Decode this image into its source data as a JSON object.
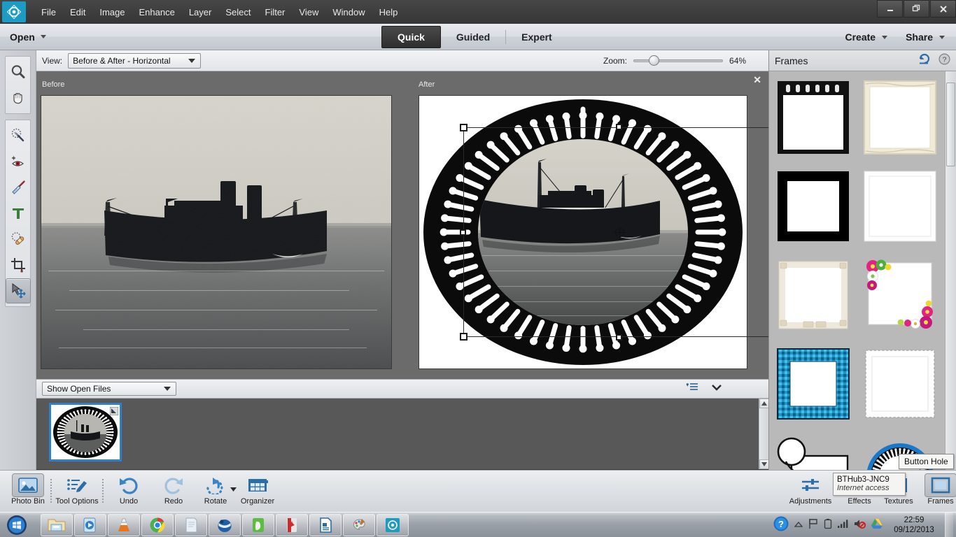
{
  "window": {
    "app_name": "Adobe Photoshop Elements",
    "minimize": "—",
    "restore": "❐",
    "close": "✕"
  },
  "menubar": {
    "items": [
      {
        "label": "File"
      },
      {
        "label": "Edit"
      },
      {
        "label": "Image"
      },
      {
        "label": "Enhance"
      },
      {
        "label": "Layer"
      },
      {
        "label": "Select"
      },
      {
        "label": "Filter"
      },
      {
        "label": "View"
      },
      {
        "label": "Window"
      },
      {
        "label": "Help"
      }
    ]
  },
  "modebar": {
    "open_label": "Open",
    "tabs": [
      {
        "label": "Quick",
        "active": true
      },
      {
        "label": "Guided",
        "active": false
      },
      {
        "label": "Expert",
        "active": false
      }
    ],
    "create_label": "Create",
    "share_label": "Share"
  },
  "optionbar": {
    "view_label": "View:",
    "view_value": "Before & After - Horizontal",
    "zoom_label": "Zoom:",
    "zoom_value": "64%",
    "zoom_percent": 64
  },
  "toolbox": {
    "tools": [
      {
        "name": "zoom-tool",
        "label": "Zoom",
        "selected": false
      },
      {
        "name": "hand-tool",
        "label": "Hand",
        "selected": false
      },
      {
        "name": "quick-selection-tool",
        "label": "Quick Selection",
        "selected": false
      },
      {
        "name": "red-eye-removal-tool",
        "label": "Red Eye Removal",
        "selected": false
      },
      {
        "name": "whiten-teeth-tool",
        "label": "Whiten Teeth",
        "selected": false
      },
      {
        "name": "type-tool",
        "label": "Type",
        "selected": false
      },
      {
        "name": "spot-healing-brush-tool",
        "label": "Spot Healing Brush",
        "selected": false
      },
      {
        "name": "crop-tool",
        "label": "Crop",
        "selected": false
      },
      {
        "name": "move-tool",
        "label": "Move",
        "selected": true
      }
    ]
  },
  "editor": {
    "before_label": "Before",
    "after_label": "After",
    "close_label": "✕"
  },
  "photobin": {
    "filter_value": "Show Open Files",
    "menu_icon": "list-menu-icon",
    "collapse_icon": "chevron-down-icon"
  },
  "frames_panel": {
    "title": "Frames",
    "reset_icon": "undo-arrow-icon",
    "help_icon": "help-icon",
    "tooltip": "Button Hole",
    "items": [
      {
        "name": "film-strip-frame",
        "style": "filmstrip"
      },
      {
        "name": "distressed-white-frame",
        "style": "distressed"
      },
      {
        "name": "thick-black-frame",
        "style": "black"
      },
      {
        "name": "thin-white-frame",
        "style": "thinwhite"
      },
      {
        "name": "polaroid-corners-frame",
        "style": "polaroid"
      },
      {
        "name": "flowers-frame",
        "style": "flowers"
      },
      {
        "name": "blue-gingham-frame",
        "style": "gingham"
      },
      {
        "name": "stamp-edge-frame",
        "style": "stamp"
      },
      {
        "name": "magnifier-frame",
        "style": "magnifier"
      },
      {
        "name": "button-hole-frame",
        "style": "buttonhole"
      }
    ]
  },
  "bottombar": {
    "left_buttons": [
      {
        "name": "photo-bin-button",
        "label": "Photo Bin",
        "icon": "photo-bin-icon",
        "selected": true
      },
      {
        "name": "tool-options-button",
        "label": "Tool Options",
        "icon": "tool-options-icon",
        "selected": false
      },
      {
        "name": "undo-button",
        "label": "Undo",
        "icon": "undo-icon",
        "selected": false
      },
      {
        "name": "redo-button",
        "label": "Redo",
        "icon": "redo-icon",
        "selected": false
      },
      {
        "name": "rotate-button",
        "label": "Rotate",
        "icon": "rotate-icon",
        "selected": false
      },
      {
        "name": "organizer-button",
        "label": "Organizer",
        "icon": "organizer-icon",
        "selected": false
      }
    ],
    "right_buttons": [
      {
        "name": "adjustments-button",
        "label": "Adjustments",
        "icon": "adjustments-icon",
        "selected": false
      },
      {
        "name": "effects-button",
        "label": "Effects",
        "icon": "effects-fx-icon",
        "selected": false
      },
      {
        "name": "textures-button",
        "label": "Textures",
        "icon": "textures-icon",
        "selected": false
      },
      {
        "name": "frames-button",
        "label": "Frames",
        "icon": "frames-icon",
        "selected": true
      }
    ]
  },
  "network_tooltip": {
    "ssid": "BTHub3-JNC9",
    "status": "Internet access"
  },
  "taskbar": {
    "start_label": "Start",
    "items": [
      {
        "name": "windows-explorer-taskbar-icon",
        "label": "Windows Explorer"
      },
      {
        "name": "media-player-taskbar-icon",
        "label": "Windows Media Player"
      },
      {
        "name": "vlc-taskbar-icon",
        "label": "VLC media player"
      },
      {
        "name": "chrome-taskbar-icon",
        "label": "Google Chrome"
      },
      {
        "name": "notepad-taskbar-icon",
        "label": "Notepad"
      },
      {
        "name": "thunderbird-taskbar-icon",
        "label": "Mozilla Thunderbird"
      },
      {
        "name": "evernote-taskbar-icon",
        "label": "Evernote"
      },
      {
        "name": "adobe-reader-taskbar-icon",
        "label": "Adobe Reader"
      },
      {
        "name": "libreoffice-taskbar-icon",
        "label": "LibreOffice"
      },
      {
        "name": "paint-taskbar-icon",
        "label": "Paint"
      },
      {
        "name": "photoshop-elements-taskbar-icon",
        "label": "Photoshop Elements"
      }
    ],
    "tray": [
      {
        "name": "action-center-icon",
        "label": "Action Center"
      },
      {
        "name": "show-hidden-icons-icon",
        "label": "Show hidden icons"
      },
      {
        "name": "network-flag-icon",
        "label": "Network"
      },
      {
        "name": "battery-icon",
        "label": "Battery"
      },
      {
        "name": "wifi-signal-icon",
        "label": "Wireless network"
      },
      {
        "name": "volume-muted-icon",
        "label": "Volume muted"
      },
      {
        "name": "google-drive-icon",
        "label": "Google Drive"
      }
    ],
    "clock_time": "22:59",
    "clock_date": "09/12/2013"
  },
  "colors": {
    "accent_blue": "#2f7fd0",
    "chrome_dark": "#3c3c3c",
    "panel_gray": "#d2d5d9",
    "canvas_gray": "#6b6b6b",
    "logo_cyan": "#1c9cc4"
  }
}
